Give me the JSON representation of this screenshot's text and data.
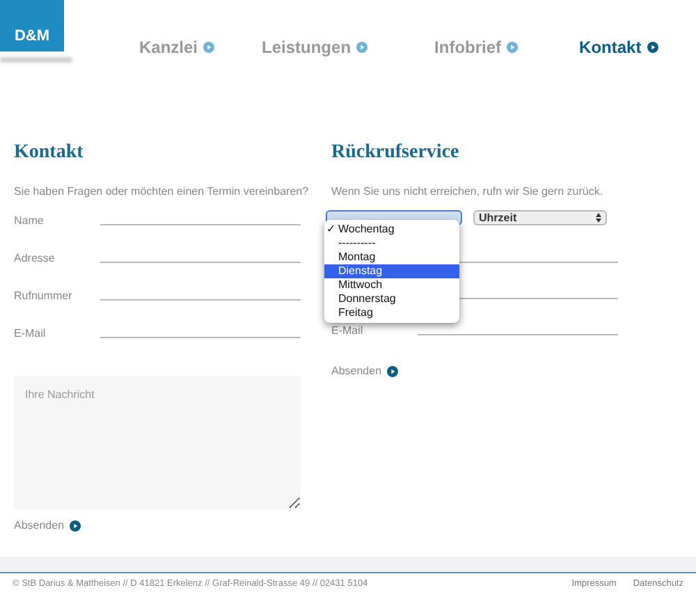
{
  "logo": {
    "text": "D&M"
  },
  "nav": [
    {
      "label": "Kanzlei",
      "selected": false
    },
    {
      "label": "Leistungen",
      "selected": false
    },
    {
      "label": "Infobrief",
      "selected": false
    },
    {
      "label": "Kontakt",
      "selected": true
    }
  ],
  "contact": {
    "title": "Kontakt",
    "intro": "Sie haben Fragen oder möchten einen Termin vereinbaren?",
    "fields": [
      {
        "label": "Name"
      },
      {
        "label": "Adresse"
      },
      {
        "label": "Rufnummer"
      },
      {
        "label": "E-Mail"
      }
    ],
    "message": {
      "placeholder": "Ihre Nachricht"
    },
    "submit": "Absenden"
  },
  "callback": {
    "title": "Rückrufservice",
    "intro": "Wenn Sie uns nicht erreichen, rufn wir Sie gern zurück.",
    "time_select": {
      "value": "Uhrzeit"
    },
    "day_menu": [
      {
        "label": "Wochentag",
        "checked": true,
        "selected": false
      },
      {
        "label": "----------",
        "checked": false,
        "selected": false
      },
      {
        "label": "Montag",
        "checked": false,
        "selected": false
      },
      {
        "label": "Dienstag",
        "checked": false,
        "selected": true
      },
      {
        "label": "Mittwoch",
        "checked": false,
        "selected": false
      },
      {
        "label": "Donnerstag",
        "checked": false,
        "selected": false
      },
      {
        "label": "Freitag",
        "checked": false,
        "selected": false
      }
    ],
    "fields": [
      {
        "kind": "covered"
      },
      {
        "kind": "covered"
      },
      {
        "kind": "labeled",
        "label": "E-Mail"
      }
    ],
    "submit": "Absenden",
    "check_mark": "✓"
  },
  "footer": {
    "text": "© StB Darius & Mattheisen // D 41821 Erkelenz // Graf-Reinald-Strasse 49 // 02431 5104",
    "links": [
      "Impressum",
      "Datenschutz"
    ]
  }
}
